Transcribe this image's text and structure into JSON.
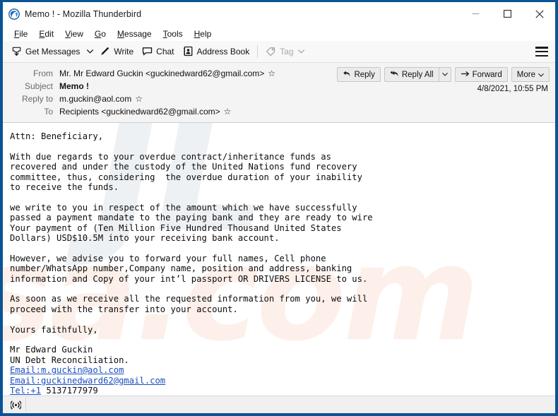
{
  "window": {
    "title": "Memo ! - Mozilla Thunderbird",
    "app_icon": "thunderbird-logo-icon",
    "controls": {
      "minimize": "minimize-icon",
      "maximize": "maximize-icon",
      "close": "close-icon"
    },
    "frame_color": "#0b5394"
  },
  "menubar": {
    "items": [
      {
        "label": "File",
        "accel": "F"
      },
      {
        "label": "Edit",
        "accel": "E"
      },
      {
        "label": "View",
        "accel": "V"
      },
      {
        "label": "Go",
        "accel": "G"
      },
      {
        "label": "Message",
        "accel": "M"
      },
      {
        "label": "Tools",
        "accel": "T"
      },
      {
        "label": "Help",
        "accel": "H"
      }
    ]
  },
  "toolbar": {
    "get_messages": "Get Messages",
    "write": "Write",
    "chat": "Chat",
    "address_book": "Address Book",
    "tag": "Tag",
    "tag_disabled": true,
    "app_menu": "hamburger-menu-icon"
  },
  "message_header": {
    "rows": [
      {
        "label": "From",
        "value": "Mr. Mr Edward Guckin <guckinedward62@gmail.com>",
        "star": true,
        "bold": false
      },
      {
        "label": "Subject",
        "value": "Memo !",
        "star": false,
        "bold": true
      },
      {
        "label": "Reply to",
        "value": "m.guckin@aol.com",
        "star": true,
        "bold": false
      },
      {
        "label": "To",
        "value": "Recipients <guckinedward62@gmail.com>",
        "star": true,
        "bold": false
      }
    ],
    "actions": {
      "reply": "Reply",
      "reply_all": "Reply All",
      "forward": "Forward",
      "more": "More"
    },
    "date": "4/8/2021, 10:55 PM"
  },
  "message_body": {
    "paragraphs": [
      "Attn: Beneficiary,",
      "",
      "With due regards to your overdue contract/inheritance funds as",
      "recovered and under the custody of the United Nations fund recovery",
      "committee, thus, considering  the overdue duration of your inability",
      "to receive the funds.",
      "",
      "we write to you in respect of the amount which we have successfully",
      "passed a payment mandate to the paying bank and they are ready to wire",
      "Your payment of (Ten Million Five Hundred Thousand United States",
      "Dollars) USD$10.5M into your receiving bank account.",
      "",
      "However, we advise you to forward your full names, Cell phone",
      "number/WhatsApp number,Company name, position and address, banking",
      "information and Copy of your int’l passport OR DRIVERS LICENSE to us.",
      "",
      "As soon as we receive all the requested information from you, we will",
      "proceed with the transfer into your account.",
      "",
      "Yours faithfully,",
      "",
      "Mr Edward Guckin",
      "UN Debt Reconciliation."
    ],
    "links": [
      {
        "text": "Email:m.guckin@aol.com"
      },
      {
        "text": "Email:guckinedward62@gmail.com"
      }
    ],
    "tel_link": "Tel:+1",
    "tel_number": " 5137177979",
    "link_color": "#1b4fbf"
  },
  "watermark": {
    "back_text": "JL",
    "front_text": "sa.com"
  },
  "statusbar": {
    "icon": "rss-broadcast-icon"
  }
}
